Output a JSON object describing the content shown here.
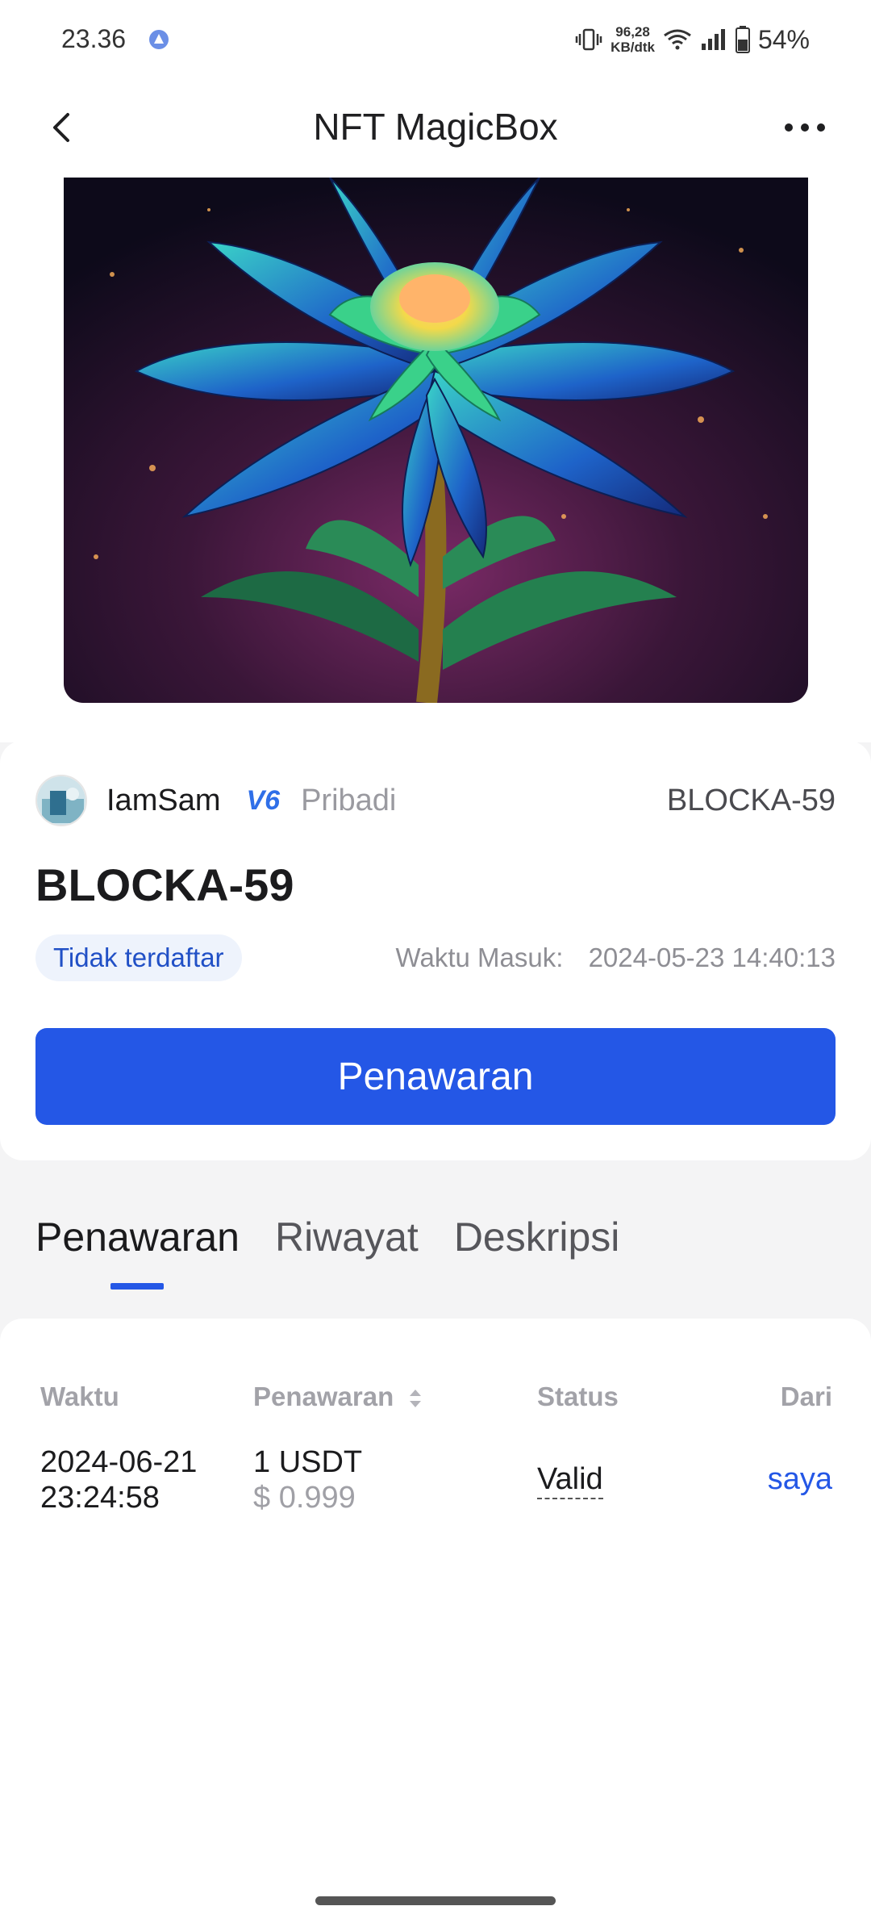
{
  "status_bar": {
    "time": "23.36",
    "net_speed_value": "96,28",
    "net_speed_unit": "KB/dtk",
    "battery": "54%"
  },
  "header": {
    "title": "NFT MagicBox"
  },
  "owner": {
    "name": "IamSam",
    "level": "V6",
    "visibility": "Pribadi",
    "nft_code": "BLOCKA-59"
  },
  "nft": {
    "name": "BLOCKA-59",
    "listing_status": "Tidak terdaftar",
    "entry_time_label": "Waktu Masuk:",
    "entry_time_value": "2024-05-23 14:40:13"
  },
  "actions": {
    "offer_button": "Penawaran"
  },
  "tabs": [
    {
      "label": "Penawaran",
      "active": true
    },
    {
      "label": "Riwayat",
      "active": false
    },
    {
      "label": "Deskripsi",
      "active": false
    }
  ],
  "offers_table": {
    "headers": {
      "time": "Waktu",
      "offer": "Penawaran",
      "status": "Status",
      "from": "Dari"
    },
    "rows": [
      {
        "date": "2024-06-21",
        "time": "23:24:58",
        "amount": "1 USDT",
        "usd": "$ 0.999",
        "status": "Valid",
        "from": "saya"
      }
    ]
  },
  "colors": {
    "accent": "#2457e6",
    "badge_bg": "#eef3fc",
    "muted_text": "#8e8e94"
  },
  "icons": [
    "back-icon",
    "more-icon",
    "sort-icon",
    "wifi-icon",
    "signal-icon",
    "battery-icon",
    "vibrate-icon"
  ]
}
